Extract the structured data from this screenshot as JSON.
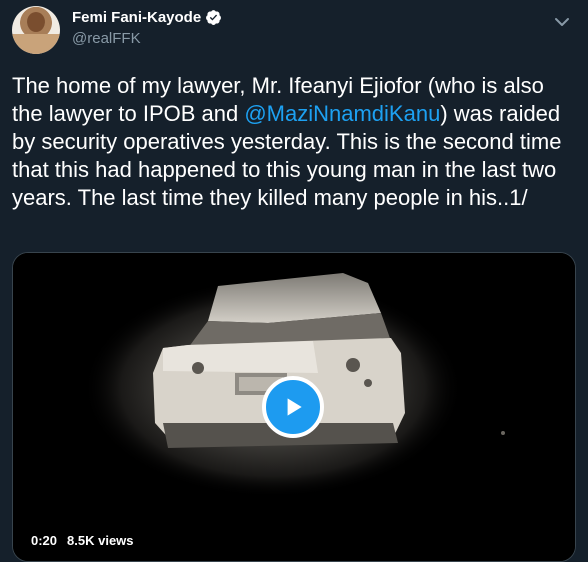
{
  "user": {
    "display_name": "Femi Fani-Kayode",
    "handle": "@realFFK",
    "verified": true
  },
  "tweet": {
    "text_before": "The home of my lawyer, Mr. Ifeanyi Ejiofor (who is also the lawyer to IPOB and ",
    "mention": "@MaziNnamdiKanu",
    "text_after": ") was raided by security operatives yesterday. This is the second time that this had happened to this young man in the last two years. The last time they killed many people in his..1/"
  },
  "video": {
    "duration": "0:20",
    "views": "8.5K views"
  },
  "icons": {
    "verified": "verified-badge-icon",
    "menu": "chevron-down-icon",
    "play": "play-icon"
  },
  "colors": {
    "background": "#15202b",
    "accent": "#1d9bf0",
    "secondary_text": "#8899a6"
  }
}
